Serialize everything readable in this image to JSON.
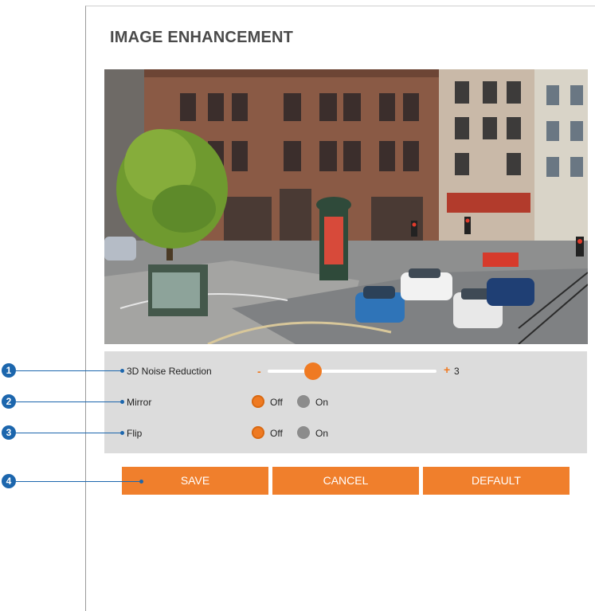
{
  "page": {
    "title": "IMAGE ENHANCEMENT"
  },
  "noise_reduction": {
    "label": "3D Noise Reduction",
    "minus": "-",
    "plus": "+",
    "value": "3",
    "level_fraction": 0.27
  },
  "mirror": {
    "label": "Mirror",
    "off_label": "Off",
    "on_label": "On",
    "selected": "Off"
  },
  "flip": {
    "label": "Flip",
    "off_label": "Off",
    "on_label": "On",
    "selected": "Off"
  },
  "buttons": {
    "save": "SAVE",
    "cancel": "CANCEL",
    "default": "DEFAULT"
  },
  "callouts": [
    "1",
    "2",
    "3",
    "4"
  ],
  "colors": {
    "accent": "#f07f2c",
    "callout": "#1c66ad",
    "panel_bg": "#dcdcdc"
  }
}
